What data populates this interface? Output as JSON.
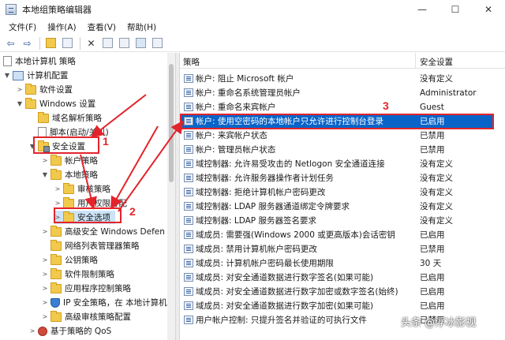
{
  "window": {
    "title": "本地组策略编辑器",
    "minimize": "—",
    "maximize": "☐",
    "close": "✕"
  },
  "menu": [
    {
      "label": "文件(F)"
    },
    {
      "label": "操作(A)"
    },
    {
      "label": "查看(V)"
    },
    {
      "label": "帮助(H)"
    }
  ],
  "tree": {
    "root": "本地计算机 策略",
    "computer_config": "计算机配置",
    "software_settings": "软件设置",
    "windows_settings": "Windows 设置",
    "dns": "域名解析策略",
    "scripts": "脚本(启动/关机)",
    "security_settings": "安全设置",
    "account_policies": "帐户策略",
    "local_policies": "本地策略",
    "audit_policy": "审核策略",
    "user_rights": "用户权限分配",
    "security_options": "安全选项",
    "firewall": "高级安全 Windows Defen",
    "network_list": "网络列表管理器策略",
    "public_key": "公钥策略",
    "software_restriction": "软件限制策略",
    "app_control": "应用程序控制策略",
    "ip_security": "IP 安全策略，在 本地计算机",
    "adv_audit": "高级审核策略配置",
    "qos": "基于策略的 QoS"
  },
  "list": {
    "col_policy": "策略",
    "col_setting": "安全设置",
    "rows": [
      {
        "name": "帐户: 阻止 Microsoft 帐户",
        "value": "没有定义"
      },
      {
        "name": "帐户: 重命名系统管理员帐户",
        "value": "Administrator"
      },
      {
        "name": "帐户: 重命名来宾帐户",
        "value": "Guest"
      },
      {
        "name": "帐户: 使用空密码的本地帐户只允许进行控制台登录",
        "value": "已启用"
      },
      {
        "name": "帐户: 来宾帐户状态",
        "value": "已禁用"
      },
      {
        "name": "帐户: 管理员帐户状态",
        "value": "已禁用"
      },
      {
        "name": "域控制器: 允许易受攻击的 Netlogon 安全通道连接",
        "value": "没有定义"
      },
      {
        "name": "域控制器: 允许服务器操作者计划任务",
        "value": "没有定义"
      },
      {
        "name": "域控制器: 拒绝计算机帐户密码更改",
        "value": "没有定义"
      },
      {
        "name": "域控制器: LDAP 服务器通道绑定令牌要求",
        "value": "没有定义"
      },
      {
        "name": "域控制器: LDAP 服务器签名要求",
        "value": "没有定义"
      },
      {
        "name": "域成员: 需要强(Windows 2000 或更高版本)会话密钥",
        "value": "已启用"
      },
      {
        "name": "域成员: 禁用计算机帐户密码更改",
        "value": "已禁用"
      },
      {
        "name": "域成员: 计算机帐户密码最长使用期限",
        "value": "30 天"
      },
      {
        "name": "域成员: 对安全通道数据进行数字签名(如果可能)",
        "value": "已启用"
      },
      {
        "name": "域成员: 对安全通道数据进行数字加密或数字签名(始终)",
        "value": "已启用"
      },
      {
        "name": "域成员: 对安全通道数据进行数字加密(如果可能)",
        "value": "已启用"
      },
      {
        "name": "用户帐户控制: 只提升签名并验证的可执行文件",
        "value": "已禁用"
      }
    ]
  },
  "annotations": {
    "n1": "1",
    "n2": "2",
    "n3": "3"
  },
  "watermark": "头条 @浮冰影视",
  "colors": {
    "annotation": "#e3242b",
    "selection": "#0a64c8"
  }
}
